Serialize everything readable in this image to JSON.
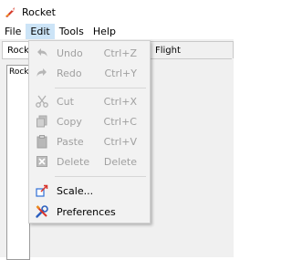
{
  "window": {
    "title": "Rocket"
  },
  "menubar": {
    "items": [
      "File",
      "Edit",
      "Tools",
      "Help"
    ],
    "active": "Edit"
  },
  "tabs": {
    "left_label": "Rock",
    "right_label": "Flight simulations"
  },
  "panel": {
    "inner_label": "Rock"
  },
  "edit_menu": {
    "items": [
      {
        "label": "Undo",
        "shortcut": "Ctrl+Z",
        "icon": "undo-icon",
        "enabled": false
      },
      {
        "label": "Redo",
        "shortcut": "Ctrl+Y",
        "icon": "redo-icon",
        "enabled": false
      },
      {
        "label": "Cut",
        "shortcut": "Ctrl+X",
        "icon": "scissors-icon",
        "enabled": false
      },
      {
        "label": "Copy",
        "shortcut": "Ctrl+C",
        "icon": "copy-icon",
        "enabled": false
      },
      {
        "label": "Paste",
        "shortcut": "Ctrl+V",
        "icon": "paste-icon",
        "enabled": false
      },
      {
        "label": "Delete",
        "shortcut": "Delete",
        "icon": "delete-icon",
        "enabled": false
      },
      {
        "label": "Scale...",
        "shortcut": "",
        "icon": "scale-icon",
        "enabled": true
      },
      {
        "label": "Preferences",
        "shortcut": "",
        "icon": "preferences-icon",
        "enabled": true
      }
    ]
  },
  "colors": {
    "menu_bg": "#f2f2f2",
    "disabled_text": "#a0a0a0",
    "active_menu_highlight": "#cce4f7",
    "workspace_bg": "#f0f0f0"
  }
}
